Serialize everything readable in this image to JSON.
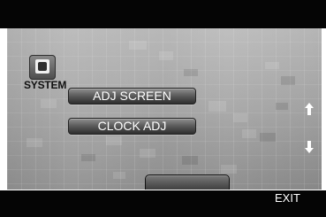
{
  "header": {
    "label": ""
  },
  "system": {
    "label": "SYSTEM"
  },
  "menu": {
    "items": [
      {
        "label": "ADJ SCREEN"
      },
      {
        "label": "CLOCK ADJ"
      }
    ]
  },
  "controls": {
    "scroll_up": "↑",
    "scroll_down": "↓"
  },
  "footer": {
    "exit_label": "EXIT"
  },
  "colors": {
    "background": "#b4b4b4",
    "button": "#5a5a5a",
    "text": "#ffffff"
  }
}
